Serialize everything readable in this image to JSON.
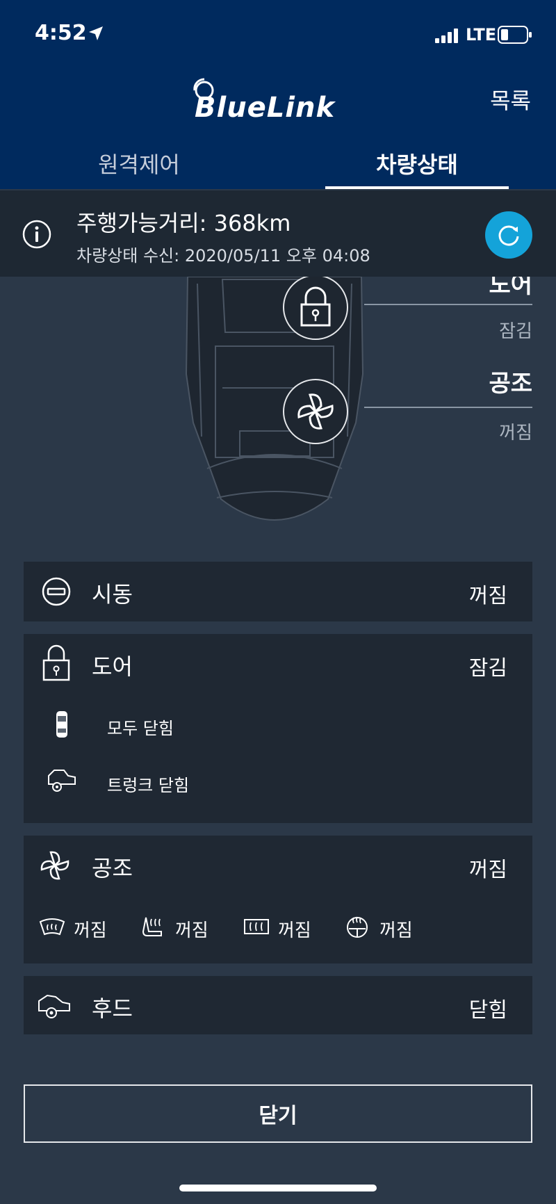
{
  "status_bar": {
    "time": "4:52",
    "carrier": "LTE"
  },
  "header": {
    "logo_text": "BlueLink",
    "list_label": "목록"
  },
  "tabs": [
    {
      "label": "원격제어",
      "active": false
    },
    {
      "label": "차량상태",
      "active": true
    }
  ],
  "info": {
    "range": "주행가능거리: 368km",
    "received": "차량상태 수신: 2020/05/11 오후 04:08"
  },
  "car_panel": {
    "door": {
      "title": "도어",
      "value": "잠김"
    },
    "ac": {
      "title": "공조",
      "value": "꺼짐"
    }
  },
  "cards": {
    "ignition": {
      "title": "시동",
      "value": "꺼짐"
    },
    "door": {
      "title": "도어",
      "value": "잠김",
      "sub": [
        {
          "label": "모두 닫힘",
          "icon": "car-top-icon"
        },
        {
          "label": "트렁크 닫힘",
          "icon": "car-trunk-icon"
        }
      ]
    },
    "climate": {
      "title": "공조",
      "value": "꺼짐",
      "items": [
        {
          "icon": "front-defrost-icon",
          "value": "꺼짐"
        },
        {
          "icon": "heated-seat-icon",
          "value": "꺼짐"
        },
        {
          "icon": "rear-defrost-icon",
          "value": "꺼짐"
        },
        {
          "icon": "heated-steering-icon",
          "value": "꺼짐"
        }
      ]
    },
    "hood": {
      "title": "후드",
      "value": "닫힘"
    }
  },
  "close_label": "닫기",
  "colors": {
    "header_bg": "#002a5e",
    "accent": "#14a3d9",
    "page_bg": "#2b3848",
    "card_bg": "#1f2833"
  }
}
